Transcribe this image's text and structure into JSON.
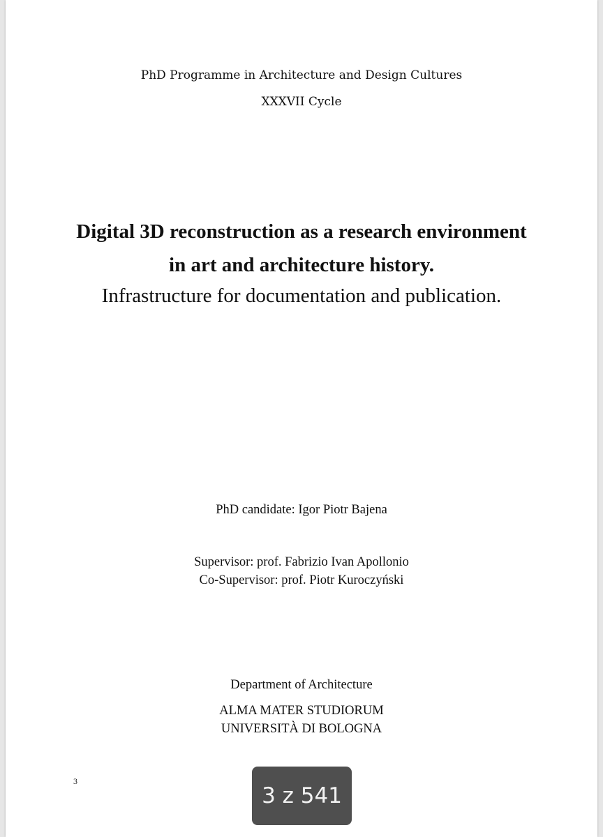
{
  "document": {
    "programme": "PhD Programme in Architecture and Design Cultures",
    "cycle": "XXXVII Cycle",
    "title_line1": "Digital 3D reconstruction as a research environment",
    "title_line2": "in art and architecture history.",
    "subtitle": "Infrastructure for documentation and publication.",
    "candidate": "PhD candidate: Igor Piotr Bajena",
    "supervisor": "Supervisor: prof. Fabrizio Ivan Apollonio",
    "co_supervisor": "Co-Supervisor: prof. Piotr Kuroczyński",
    "department": "Department of Architecture",
    "university_line1": "ALMA MATER STUDIORUM",
    "university_line2": "UNIVERSITÀ DI BOLOGNA",
    "page_number": "3"
  },
  "viewer": {
    "page_indicator": "3 z 541"
  }
}
